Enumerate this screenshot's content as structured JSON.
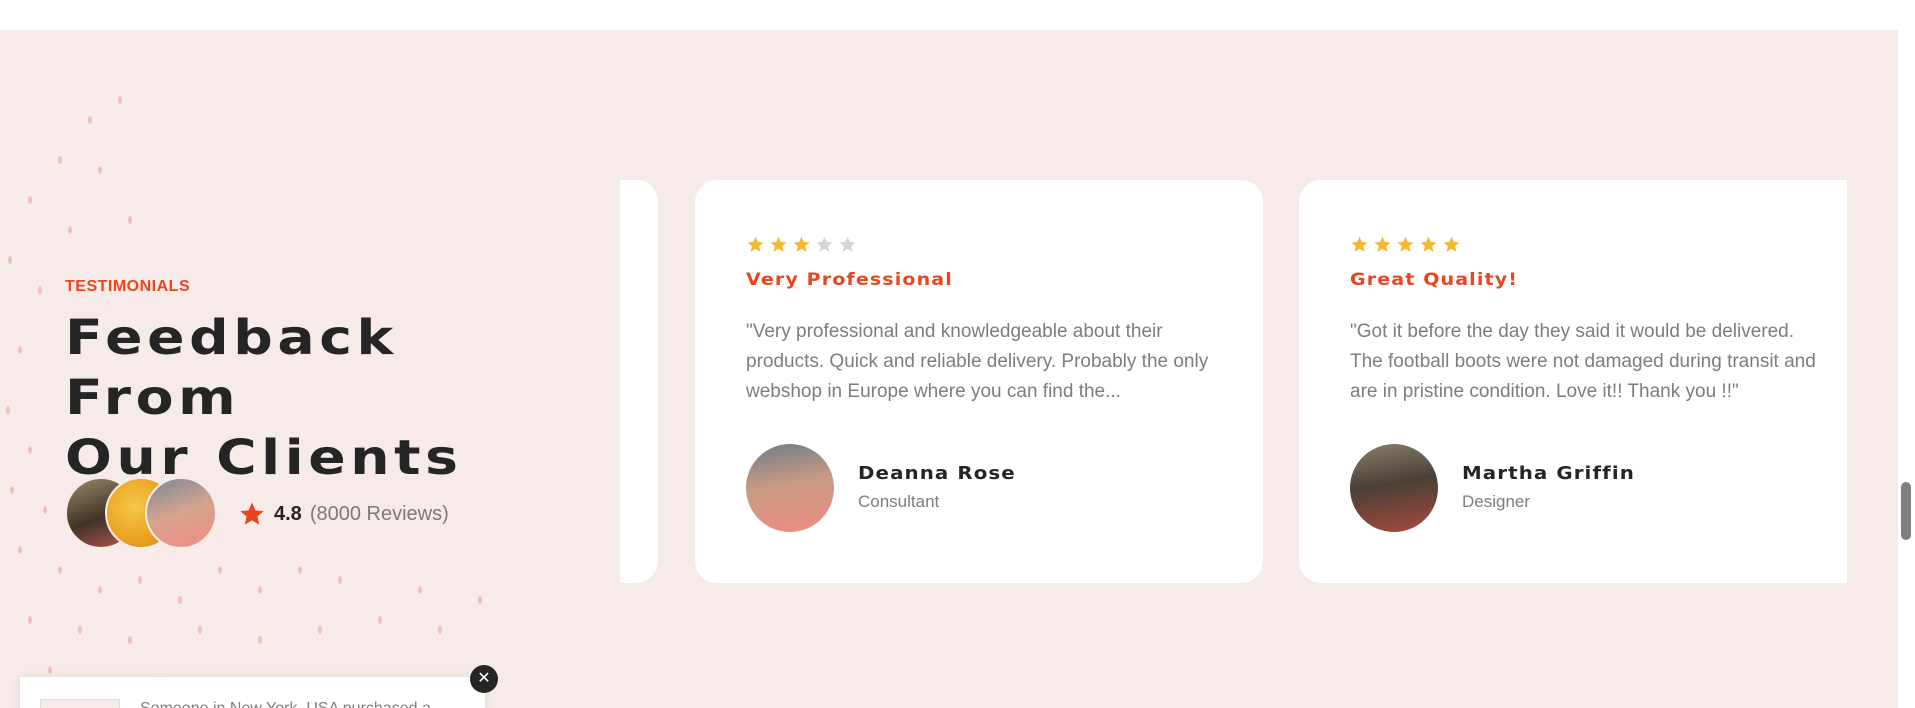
{
  "section": {
    "eyebrow": "TESTIMONIALS",
    "heading_line1": "Feedback From",
    "heading_line2": "Our Clients",
    "rating_value": "4.8",
    "rating_count": "(8000 Reviews)"
  },
  "testimonials": [
    {
      "stars": 3,
      "stars_max": 5,
      "title": "Very Professional",
      "quote": "\"Very professional and knowledgeable about their products. Quick and reliable delivery. Probably the only webshop in Europe where you can find the...",
      "name": "Deanna Rose",
      "role": "Consultant"
    },
    {
      "stars": 5,
      "stars_max": 5,
      "title": "Great Quality!",
      "quote": "\"Got it before the day they said it would be delivered. The football boots were not damaged during transit and are in pristine condition. Love it!! Thank you !!\"",
      "name": "Martha Griffin",
      "role": "Designer"
    }
  ],
  "popup": {
    "text": "Someone in New York, USA purchased a",
    "close_label": "✕"
  },
  "colors": {
    "accent": "#e8461f",
    "star": "#f5b832",
    "star_empty": "#d4d4d4",
    "section_bg": "#f7ebe9",
    "heading": "#252525"
  }
}
